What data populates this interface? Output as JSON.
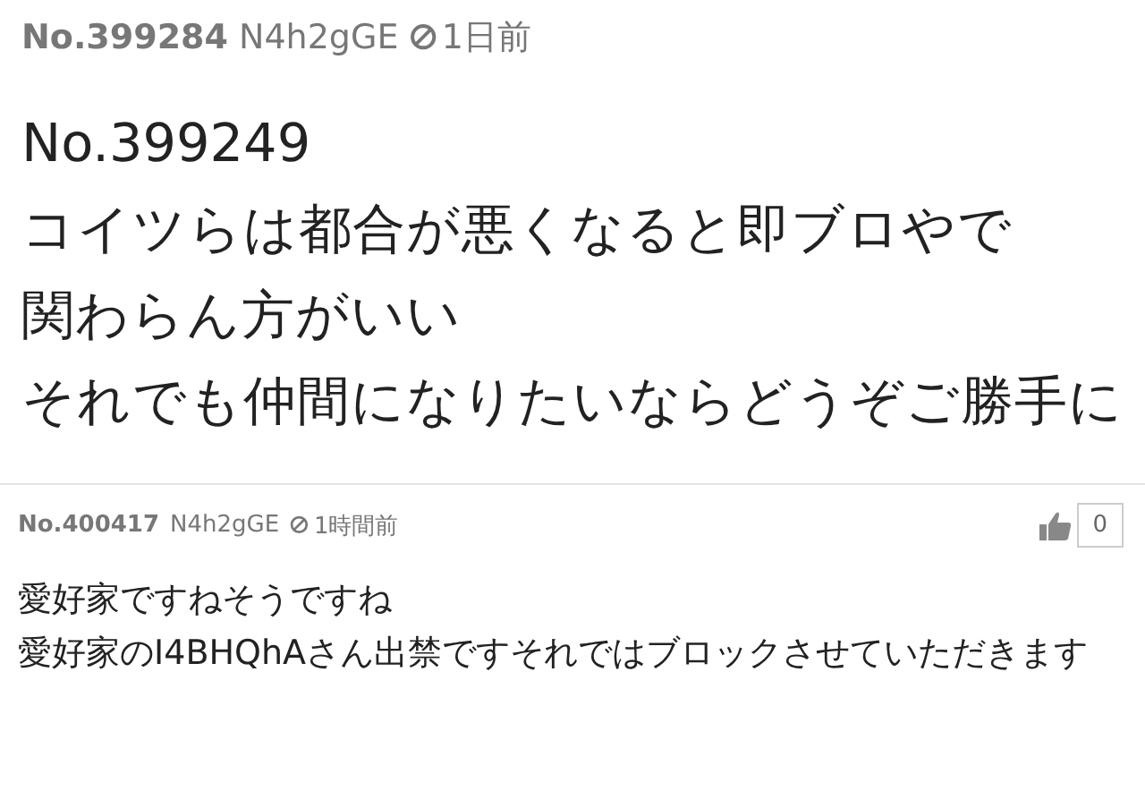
{
  "posts": [
    {
      "number": "No.399284",
      "id": "N4h2gGE",
      "time": "1日前",
      "lines": [
        "No.399249",
        "コイツらは都合が悪くなると即ブロやで",
        "関わらん方がいい",
        "それでも仲間になりたいならどうぞご勝手に"
      ],
      "kind": "thread"
    },
    {
      "number": "No.400417",
      "id": "N4h2gGE",
      "time": "1時間前",
      "likes": "0",
      "lines": [
        "愛好家ですねそうですね",
        "愛好家のI4BHQhAさん出禁ですそれではブロックさせていただきます"
      ],
      "kind": "reply"
    }
  ]
}
